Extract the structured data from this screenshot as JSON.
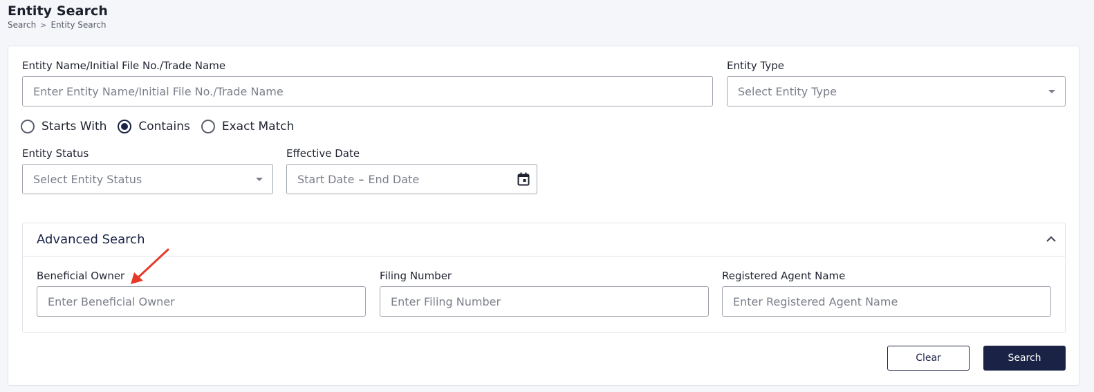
{
  "header": {
    "title": "Entity Search",
    "breadcrumb": [
      "Search",
      "Entity Search"
    ],
    "breadcrumb_separator": ">"
  },
  "form": {
    "entity_name": {
      "label": "Entity Name/Initial File No./Trade Name",
      "placeholder": "Enter Entity Name/Initial File No./Trade Name",
      "value": ""
    },
    "entity_type": {
      "label": "Entity Type",
      "placeholder": "Select Entity Type"
    },
    "match_mode": {
      "options": [
        "Starts With",
        "Contains",
        "Exact Match"
      ],
      "selected": "Contains"
    },
    "entity_status": {
      "label": "Entity Status",
      "placeholder": "Select Entity Status"
    },
    "effective_date": {
      "label": "Effective Date",
      "start_placeholder": "Start Date",
      "separator": "–",
      "end_placeholder": "End Date"
    }
  },
  "advanced_search": {
    "title": "Advanced Search",
    "expanded": true,
    "beneficial_owner": {
      "label": "Beneficial Owner",
      "placeholder": "Enter Beneficial Owner",
      "value": ""
    },
    "filing_number": {
      "label": "Filing Number",
      "placeholder": "Enter Filing Number",
      "value": ""
    },
    "registered_agent_name": {
      "label": "Registered Agent Name",
      "placeholder": "Enter Registered Agent Name",
      "value": ""
    }
  },
  "actions": {
    "clear_label": "Clear",
    "search_label": "Search"
  },
  "colors": {
    "primary": "#1a2346",
    "annotation_arrow": "#e53a2b",
    "border": "#9ea3ad",
    "background": "#f5f6fa"
  },
  "icons": [
    "calendar-icon",
    "chevron-down-icon",
    "chevron-up-icon",
    "annotation-arrow-icon"
  ]
}
